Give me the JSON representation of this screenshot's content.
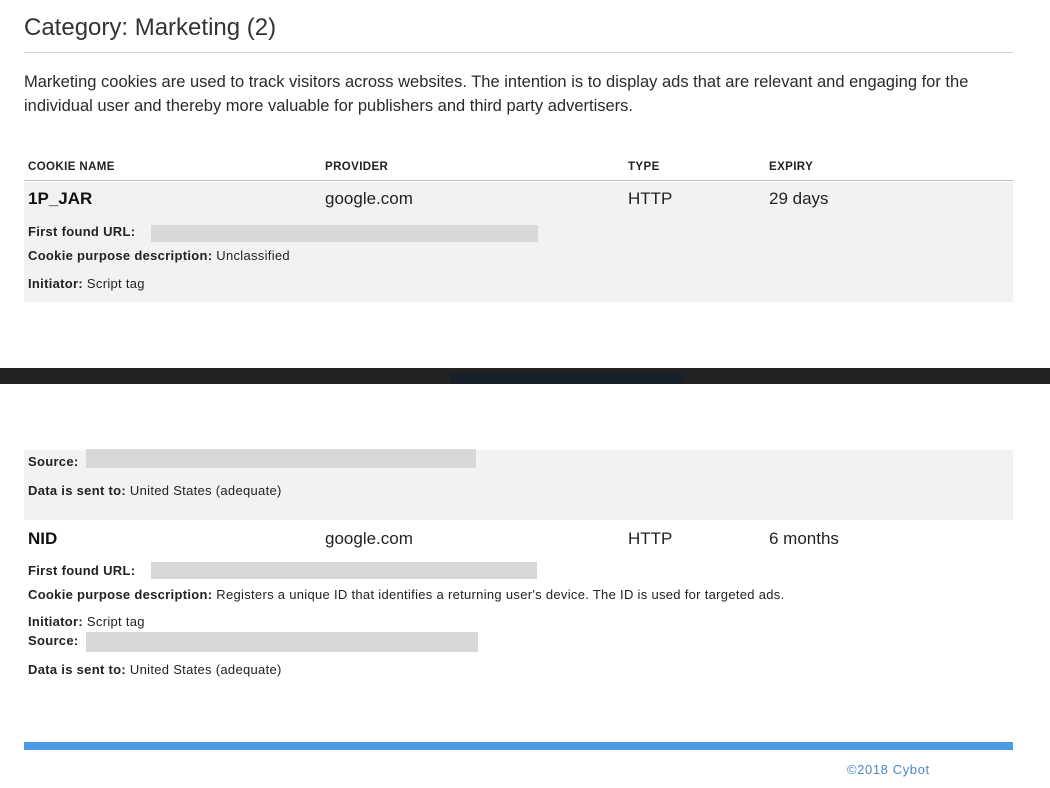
{
  "category": {
    "title": "Category: Marketing (2)",
    "description": "Marketing cookies are used to track visitors across websites. The intention is to display ads that are relevant and engaging for the individual user and thereby more valuable for publishers and third party advertisers."
  },
  "table": {
    "headers": {
      "name": "COOKIE NAME",
      "provider": "PROVIDER",
      "type": "TYPE",
      "expiry": "EXPIRY"
    }
  },
  "labels": {
    "first_found": "First found URL:",
    "purpose": "Cookie purpose description:",
    "initiator": "Initiator:",
    "source": "Source:",
    "sent_to": "Data is sent to:"
  },
  "cookies": [
    {
      "name": "1P_JAR",
      "provider": "google.com",
      "type": "HTTP",
      "expiry": "29 days",
      "purpose": "Unclassified",
      "initiator": "Script tag",
      "sent_to": "United States (adequate)"
    },
    {
      "name": "NID",
      "provider": "google.com",
      "type": "HTTP",
      "expiry": "6 months",
      "purpose": "Registers a unique ID that identifies a returning user's device. The ID is used for targeted ads.",
      "initiator": "Script tag",
      "sent_to": "United States (adequate)"
    }
  ],
  "footer": {
    "copyright": "©2018 Cybot"
  },
  "colors": {
    "accent": "#4a9be4",
    "row_bg": "#f2f2f2",
    "band": "#222222"
  }
}
